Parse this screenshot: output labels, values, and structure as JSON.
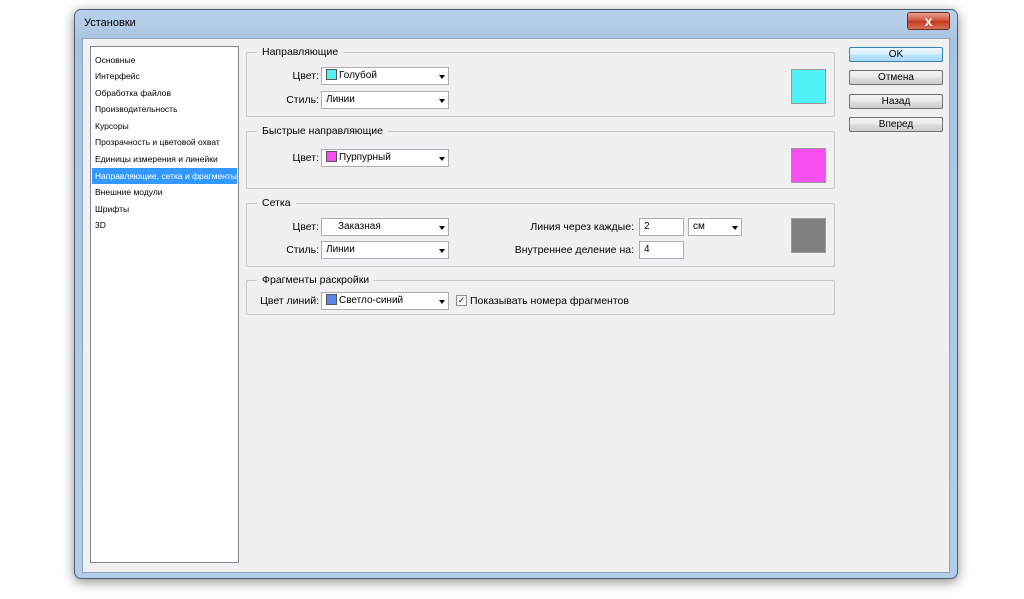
{
  "window": {
    "title": "Установки",
    "close_glyph": "x"
  },
  "nav": {
    "items": [
      "Основные",
      "Интерфейс",
      "Обработка файлов",
      "Производительность",
      "Курсоры",
      "Прозрачность и цветовой охват",
      "Единицы измерения и линейки",
      "Направляющие, сетка и фрагменты",
      "Внешние модули",
      "Шрифты",
      "3D"
    ],
    "selected_index": 7
  },
  "guides": {
    "legend": "Направляющие",
    "color_label": "Цвет:",
    "color_value": "Голубой",
    "color_hex": "#4ff2f5",
    "style_label": "Стиль:",
    "style_value": "Линии"
  },
  "smart_guides": {
    "legend": "Быстрые направляющие",
    "color_label": "Цвет:",
    "color_value": "Пурпурный",
    "color_hex": "#f54ff2"
  },
  "grid": {
    "legend": "Сетка",
    "color_label": "Цвет:",
    "color_value": "Заказная",
    "color_hex": "#808080",
    "style_label": "Стиль:",
    "style_value": "Линии",
    "gridline_label": "Линия через каждые:",
    "gridline_value": "2",
    "unit_value": "см",
    "subdiv_label": "Внутреннее деление на:",
    "subdiv_value": "4"
  },
  "slices": {
    "legend": "Фрагменты раскройки",
    "line_color_label": "Цвет линий:",
    "line_color_value": "Светло-синий",
    "line_color_hex": "#5a86e8",
    "show_numbers_label": "Показывать номера фрагментов",
    "show_numbers_checked": true
  },
  "buttons": {
    "ok": "OK",
    "cancel": "Отмена",
    "prev": "Назад",
    "next": "Вперед"
  }
}
